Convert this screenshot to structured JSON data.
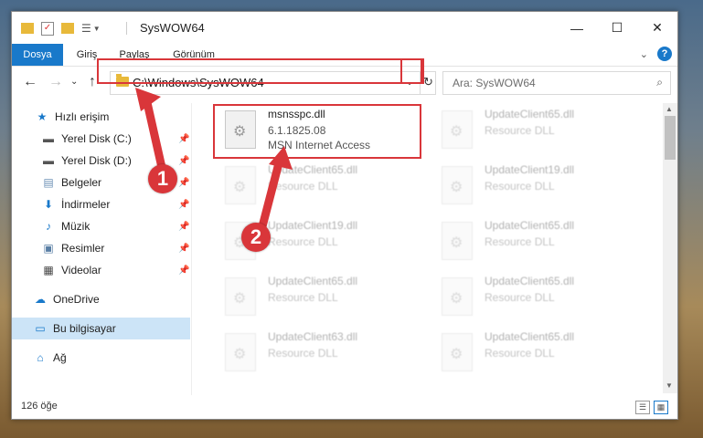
{
  "window": {
    "title": "SysWOW64"
  },
  "ribbon": {
    "tabs": [
      "Dosya",
      "Giriş",
      "Paylaş",
      "Görünüm"
    ]
  },
  "address": {
    "path": "C:\\Windows\\SysWOW64"
  },
  "search": {
    "placeholder": "Ara: SysWOW64"
  },
  "sidebar": {
    "items": [
      {
        "label": "Hızlı erişim",
        "icon": "star-icon"
      },
      {
        "label": "Yerel Disk (C:)",
        "icon": "drive-icon",
        "pinned": true
      },
      {
        "label": "Yerel Disk (D:)",
        "icon": "drive-icon",
        "pinned": true
      },
      {
        "label": "Belgeler",
        "icon": "documents-icon",
        "pinned": true
      },
      {
        "label": "İndirmeler",
        "icon": "download-icon",
        "pinned": true
      },
      {
        "label": "Müzik",
        "icon": "music-icon",
        "pinned": true
      },
      {
        "label": "Resimler",
        "icon": "pictures-icon",
        "pinned": true
      },
      {
        "label": "Videolar",
        "icon": "videos-icon",
        "pinned": true
      },
      {
        "label": "OneDrive",
        "icon": "cloud-icon"
      },
      {
        "label": "Bu bilgisayar",
        "icon": "computer-icon",
        "selected": true
      },
      {
        "label": "Ağ",
        "icon": "network-icon"
      }
    ]
  },
  "files": [
    {
      "name": "msnsspc.dll",
      "version": "6.1.1825.08",
      "desc": "MSN Internet Access",
      "highlighted": true
    },
    {
      "name": "UpdateClient65.dll",
      "desc": "Resource DLL"
    },
    {
      "name": "UpdateClient65.dll",
      "desc": "Resource DLL"
    },
    {
      "name": "UpdateClient19.dll",
      "desc": "Resource DLL"
    },
    {
      "name": "UpdateClient19.dll",
      "desc": "Resource DLL"
    },
    {
      "name": "UpdateClient65.dll",
      "desc": "Resource DLL"
    },
    {
      "name": "UpdateClient65.dll",
      "desc": "Resource DLL"
    },
    {
      "name": "UpdateClient65.dll",
      "desc": "Resource DLL"
    },
    {
      "name": "UpdateClient63.dll",
      "desc": "Resource DLL"
    },
    {
      "name": "UpdateClient65.dll",
      "desc": "Resource DLL"
    }
  ],
  "status": {
    "count": "126 öğe"
  },
  "markers": [
    "1",
    "2"
  ],
  "colors": {
    "accent": "#1979ca",
    "annotation": "#d9363a"
  }
}
